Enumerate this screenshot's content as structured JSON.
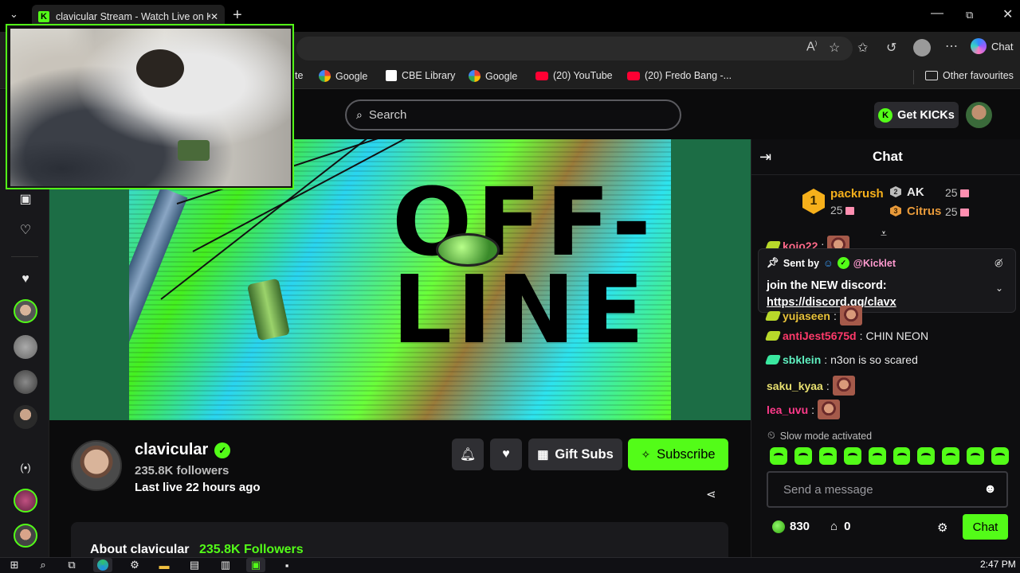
{
  "browser": {
    "tab_title": "clavicular Stream - Watch Live on Kick",
    "tab_close": "✕",
    "new_tab": "+",
    "window_min": "—",
    "window_max": "⧉",
    "window_close": "✕",
    "copilot_label": "Chat",
    "bookmarks": [
      {
        "label": "te",
        "icon": "site-icon"
      },
      {
        "label": "Google",
        "icon": "google-icon"
      },
      {
        "label": "CBE Library",
        "icon": "library-icon"
      },
      {
        "label": "Google",
        "icon": "google-icon"
      },
      {
        "label": "(20) YouTube",
        "icon": "youtube-icon"
      },
      {
        "label": "(20) Fredo Bang -...",
        "icon": "youtube-icon"
      }
    ],
    "other_favourites": "Other favourites"
  },
  "header": {
    "search_placeholder": "Search",
    "get_kicks": "Get KICKs"
  },
  "player": {
    "offline_line1": "OFF-",
    "offline_line2": "LINE"
  },
  "channel": {
    "name": "clavicular",
    "verified_mark": "✓",
    "followers": "235.8K followers",
    "last_live": "Last live 22 hours ago",
    "gift_subs": "Gift Subs",
    "subscribe": "Subscribe",
    "about_title": "About clavicular",
    "about_followers": "235.8K Followers"
  },
  "chat": {
    "title": "Chat",
    "leaderboard": [
      {
        "rank": "1",
        "name": "packrush",
        "value": "25",
        "color": "#f6b01b"
      },
      {
        "rank": "2",
        "name": "AK",
        "value": "25",
        "color": "#e8e8e8"
      },
      {
        "rank": "3",
        "name": "Citrus",
        "value": "25",
        "color": "#e89a3a"
      }
    ],
    "pinned": {
      "sent_by_label": "Sent by",
      "sender": "@Kicklet",
      "message": "join the NEW discord:",
      "link": "https://discord.gg/clavx"
    },
    "messages": [
      {
        "user": "kojo22",
        "text": "",
        "color": "#ff6a8a",
        "emote": true
      },
      {
        "user": "yujaseen",
        "text": "",
        "color": "#e8c23a",
        "emote": true
      },
      {
        "user": "antiJest5675d",
        "text": "CHIN NEON",
        "color": "#ff3a6a",
        "emote": false
      },
      {
        "user": "sbklein",
        "text": "n3on is so scared",
        "color": "#5ff0c0",
        "emote": false
      },
      {
        "user": "saku_kyaa",
        "text": "",
        "color": "#e8e070",
        "emote": true
      },
      {
        "user": "lea_uvu",
        "text": "",
        "color": "#ff3a8a",
        "emote": true
      }
    ],
    "slow_mode": "Slow mode activated",
    "input_placeholder": "Send a message",
    "points": "830",
    "store_count": "0",
    "send_label": "Chat"
  },
  "taskbar": {
    "clock": "2:47 PM"
  },
  "colors": {
    "accent": "#53fc18",
    "background": "#0b0b0c"
  }
}
